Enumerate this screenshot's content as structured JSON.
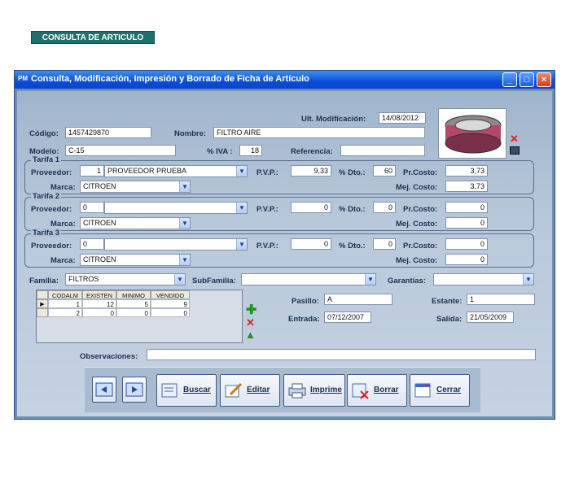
{
  "window": {
    "title": "Consulta, Modificación, Impresión y Borrado de Ficha de Artículo",
    "app_icon": "PM"
  },
  "header": {
    "badge": "CONSULTA DE ARTICULO",
    "ult_mod_label": "Ult. Modificación:",
    "ult_mod_value": "14/08/2012"
  },
  "fields": {
    "codigo_label": "Código:",
    "codigo": "1457429870",
    "nombre_label": "Nombre:",
    "nombre": "FILTRO AIRE",
    "modelo_label": "Modelo:",
    "modelo": "C-15",
    "iva_label": "% IVA :",
    "iva": "18",
    "referencia_label": "Referencia:",
    "referencia": ""
  },
  "tarifas": [
    {
      "title": "Tarifa 1",
      "proveedor_label": "Proveedor:",
      "proveedor_num": "1",
      "proveedor_name": "PROVEEDOR PRUEBA",
      "pvp_label": "P.V.P.:",
      "pvp": "9,33",
      "dto_label": "% Dto.:",
      "dto": "60",
      "costo_label": "Pr.Costo:",
      "costo": "3,73",
      "marca_label": "Marca:",
      "marca": "CITROEN",
      "mej_label": "Mej. Costo:",
      "mej": "3,73"
    },
    {
      "title": "Tarifa 2",
      "proveedor_label": "Proveedor:",
      "proveedor_num": "0",
      "proveedor_name": "",
      "pvp_label": "P.V.P.:",
      "pvp": "0",
      "dto_label": "% Dto.:",
      "dto": "0",
      "costo_label": "Pr.Costo:",
      "costo": "0",
      "marca_label": "Marca:",
      "marca": "CITROEN",
      "mej_label": "Mej. Costo:",
      "mej": "0"
    },
    {
      "title": "Tarifa 3",
      "proveedor_label": "Proveedor:",
      "proveedor_num": "0",
      "proveedor_name": "",
      "pvp_label": "P.V.P.:",
      "pvp": "0",
      "dto_label": "% Dto.:",
      "dto": "0",
      "costo_label": "Pr.Costo:",
      "costo": "0",
      "marca_label": "Marca:",
      "marca": "CITROEN",
      "mej_label": "Mej. Costo:",
      "mej": "0"
    }
  ],
  "familia": {
    "label": "Familia:",
    "value": "FILTROS",
    "subfamilia_label": "SubFamilia:",
    "subfamilia": "",
    "garantias_label": "Garantías:",
    "garantias": ""
  },
  "stock_grid": {
    "headers": [
      "CODALM",
      "EXISTEN",
      "MINIMO",
      "VENDIDO"
    ],
    "rows": [
      [
        "1",
        "12",
        "5",
        "9"
      ],
      [
        "2",
        "0",
        "0",
        "0"
      ]
    ]
  },
  "location": {
    "pasillo_label": "Pasillo:",
    "pasillo": "A",
    "estante_label": "Estante:",
    "estante": "1",
    "entrada_label": "Entrada:",
    "entrada": "07/12/2007",
    "salida_label": "Salida:",
    "salida": "21/05/2009"
  },
  "observaciones_label": "Observaciones:",
  "buttons": {
    "buscar": "Buscar",
    "editar": "Editar",
    "imprimir": "Imprime",
    "borrar": "Borrar",
    "cerrar": "Cerrar"
  },
  "icons": {
    "prev": "prev-record-icon",
    "next": "next-record-icon",
    "add": "add-icon",
    "delete": "delete-icon",
    "warn": "warning-icon"
  }
}
